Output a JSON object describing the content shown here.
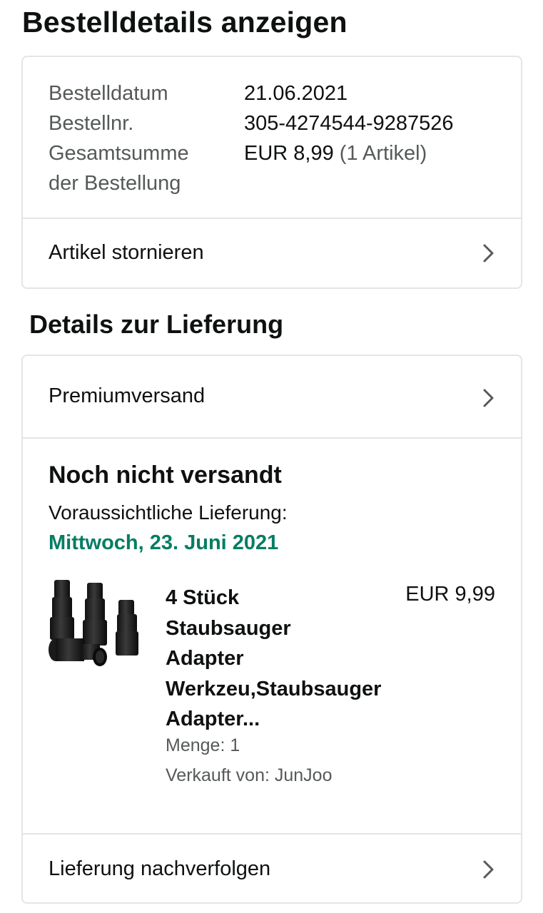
{
  "page": {
    "title": "Bestelldetails anzeigen"
  },
  "summary": {
    "rows": [
      {
        "label": "Bestelldatum",
        "value": "21.06.2021"
      },
      {
        "label": "Bestellnr.",
        "value": "305-4274544-9287526"
      },
      {
        "label_line1": "Gesamtsumme",
        "label_line2": "der Bestellung",
        "value": "EUR 8,99",
        "value_extra": "(1 Artikel)"
      }
    ],
    "cancel_link": "Artikel stornieren"
  },
  "delivery": {
    "section_title": "Details zur Lieferung",
    "shipping_method": "Premiumversand",
    "status": "Noch nicht versandt",
    "estimate_label": "Voraussichtliche Lieferung:",
    "estimate_date": "Mittwoch, 23. Juni 2021",
    "estimate_color": "#067d62",
    "product": {
      "title_lines": [
        "4 Stück",
        "Staubsauger",
        "Adapter",
        "Werkzeu,Staubsauger",
        "Adapter..."
      ],
      "price": "EUR 9,99",
      "quantity": "Menge: 1",
      "seller": "Verkauft von: JunJoo",
      "image_icon": "vacuum-adapter-image"
    },
    "track_link": "Lieferung nachverfolgen"
  },
  "icons": {
    "chevron": "chevron-right-icon"
  },
  "colors": {
    "border": "#e3e6e6",
    "text": "#0f1111",
    "muted": "#565959",
    "green": "#067d62"
  }
}
